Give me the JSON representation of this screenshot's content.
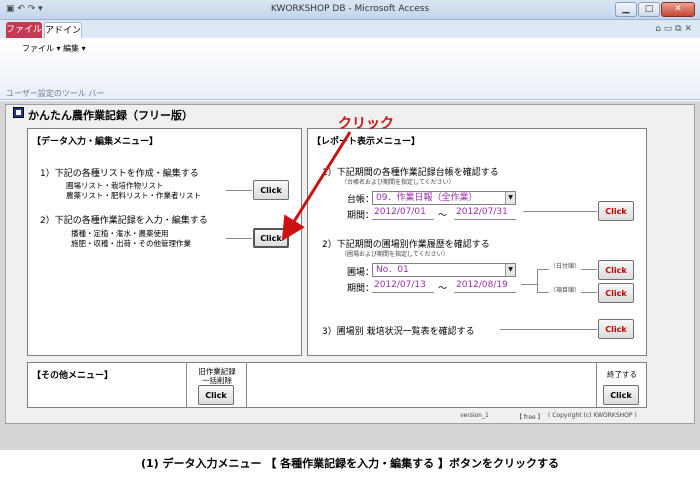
{
  "window": {
    "title": "KWORKSHOP DB - Microsoft Access"
  },
  "ribbon": {
    "tabs": [
      "ファイル",
      "アドイン"
    ],
    "menu": "ファイル ▾  編集 ▾",
    "group_label": "ユーザー設定のツール バー"
  },
  "form": {
    "title": "かんたん農作業記録（フリー版）",
    "input_menu": {
      "title": "【データ入力・編集メニュー】",
      "item1": {
        "heading": "1）下記の各種リストを作成・編集する",
        "line1": "圃場リスト・栽培作物リスト",
        "line2": "農薬リスト・肥料リスト・作業者リスト",
        "button": "Click"
      },
      "item2": {
        "heading": "2）下記の各種作業記録を入力・編集する",
        "line1": "播種・定植・潅水・農薬使用",
        "line2": "施肥・収穫・出荷・その他管理作業",
        "button": "Click"
      }
    },
    "report_menu": {
      "title": "【レポート表示メニュー】",
      "item1": {
        "heading": "1）下記期間の各種作業記録台帳を確認する",
        "note": "（台帳名および期間を指定してください）",
        "ledger_label": "台帳：",
        "ledger_value": "09．作業日報（全作業）",
        "period_label": "期間：",
        "date_from": "2012/07/01",
        "tilde": "～",
        "date_to": "2012/07/31",
        "button": "Click"
      },
      "item2": {
        "heading": "2）下記期間の圃場別作業履歴を確認する",
        "note": "（圃場および期間を指定してください）",
        "field_label": "圃場：",
        "field_value": "No．01",
        "period_label": "期間：",
        "date_from": "2012/07/13",
        "tilde": "～",
        "date_to": "2012/08/19",
        "by_date": "（日付順）",
        "by_item": "（項目順）",
        "button1": "Click",
        "button2": "Click"
      },
      "item3": {
        "heading": "3）圃場別 栽培状況一覧表を確認する",
        "button": "Click"
      }
    },
    "other_menu": {
      "title": "【その他メニュー】",
      "bulk_delete_label1": "旧作業記録",
      "bulk_delete_label2": "一括削除",
      "button": "Click"
    },
    "exit": {
      "label": "終了する",
      "button": "Click"
    },
    "footer": {
      "version": "version_1",
      "edition": "【 free 】",
      "copyright": "( Copyright (c) KWORKSHOP )"
    }
  },
  "annotation": {
    "label": "クリック",
    "arrow_color": "#cc1111"
  },
  "caption": "(1) データ入力メニュー 【 各種作業記録を入力・編集する 】ボタンをクリックする"
}
